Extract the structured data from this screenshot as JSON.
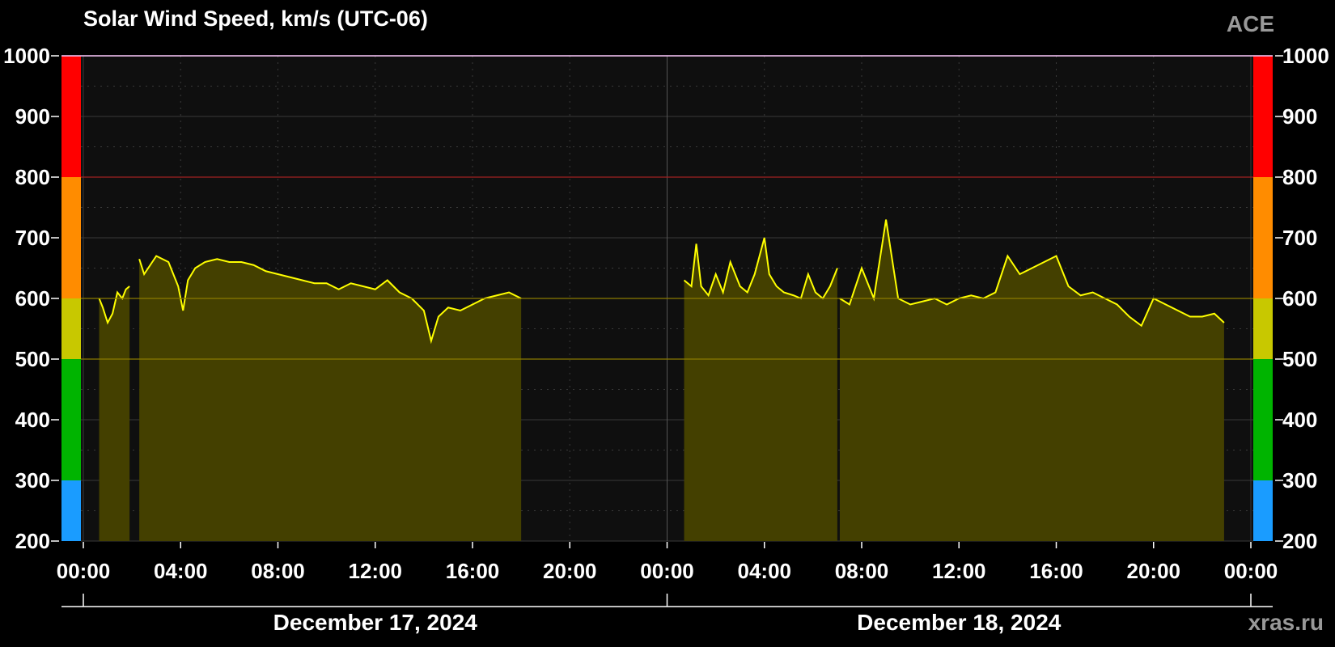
{
  "header": {
    "title": "Solar Wind Speed, km/s (UTC-06)",
    "badge": "ACE"
  },
  "footer": {
    "credit": "xras.ru"
  },
  "colors": {
    "background": "#000000",
    "plot_background": "#0f0f0f",
    "series": "#ffff00",
    "fill": "#444000",
    "grid": "#3a3a3a",
    "bands": [
      "#1a9cff",
      "#00b400",
      "#c8c800",
      "#ff8c00",
      "#ff0000"
    ]
  },
  "chart_data": {
    "type": "area",
    "title": "Solar Wind Speed, km/s (UTC-06)",
    "ylim": [
      200,
      1000
    ],
    "xlim_hours": [
      0,
      48
    ],
    "y_ticks": [
      "200",
      "300",
      "400",
      "500",
      "600",
      "700",
      "800",
      "900",
      "1000"
    ],
    "x_ticks": [
      "00:00",
      "04:00",
      "08:00",
      "12:00",
      "16:00",
      "20:00",
      "00:00",
      "04:00",
      "08:00",
      "12:00",
      "16:00",
      "20:00",
      "00:00"
    ],
    "date_labels": [
      "December 17, 2024",
      "December 18, 2024"
    ],
    "threshold_lines": [
      500,
      600,
      800
    ],
    "bands": [
      {
        "from": 200,
        "to": 300
      },
      {
        "from": 300,
        "to": 500
      },
      {
        "from": 500,
        "to": 600
      },
      {
        "from": 600,
        "to": 800
      },
      {
        "from": 800,
        "to": 1000
      }
    ],
    "series": [
      {
        "segments": [
          {
            "x": [
              0.65,
              0.8,
              1.0,
              1.2,
              1.4,
              1.6,
              1.75,
              1.9
            ],
            "y": [
              600,
              585,
              560,
              575,
              610,
              600,
              615,
              620
            ]
          },
          {
            "x": [
              2.3,
              2.5,
              3.0,
              3.5,
              3.9,
              4.1,
              4.3,
              4.6,
              5.0,
              5.5,
              6.0,
              6.5,
              7.0,
              7.5,
              8.0,
              8.5,
              9.0,
              9.5,
              10.0,
              10.5,
              11.0,
              11.5,
              12.0,
              12.5,
              13.0,
              13.5,
              14.0,
              14.3,
              14.6,
              15.0,
              15.5,
              16.0,
              16.5,
              17.0,
              17.5,
              18.0
            ],
            "y": [
              665,
              640,
              670,
              660,
              620,
              580,
              630,
              650,
              660,
              665,
              660,
              660,
              655,
              645,
              640,
              635,
              630,
              625,
              625,
              615,
              625,
              620,
              615,
              630,
              610,
              600,
              580,
              530,
              570,
              585,
              580,
              590,
              600,
              605,
              610,
              600
            ]
          }
        ]
      },
      {
        "segments": [
          {
            "x": [
              24.7,
              25.0,
              25.2,
              25.4,
              25.7,
              26.0,
              26.3,
              26.6,
              27.0,
              27.3,
              27.6,
              28.0,
              28.2,
              28.5,
              28.8,
              29.2,
              29.5,
              29.8,
              30.1,
              30.4,
              30.7,
              31.0
            ],
            "y": [
              630,
              620,
              690,
              620,
              605,
              640,
              610,
              660,
              620,
              610,
              640,
              700,
              640,
              620,
              610,
              605,
              600,
              640,
              610,
              600,
              620,
              650
            ]
          },
          {
            "x": [
              31.1,
              31.5,
              32.0,
              32.5,
              33.0,
              33.5,
              34.0,
              34.5,
              35.0,
              35.5,
              36.0,
              36.5,
              37.0,
              37.5,
              38.0,
              38.5,
              39.0,
              39.5,
              40.0,
              40.5,
              41.0,
              41.5,
              42.0,
              42.5,
              43.0,
              43.5,
              44.0,
              44.5,
              45.0,
              45.5,
              46.0,
              46.5,
              46.9
            ],
            "y": [
              600,
              590,
              650,
              600,
              730,
              600,
              590,
              595,
              600,
              590,
              600,
              605,
              600,
              610,
              670,
              640,
              650,
              660,
              670,
              620,
              605,
              610,
              600,
              590,
              570,
              555,
              600,
              590,
              580,
              570,
              570,
              575,
              560
            ]
          }
        ]
      }
    ]
  }
}
